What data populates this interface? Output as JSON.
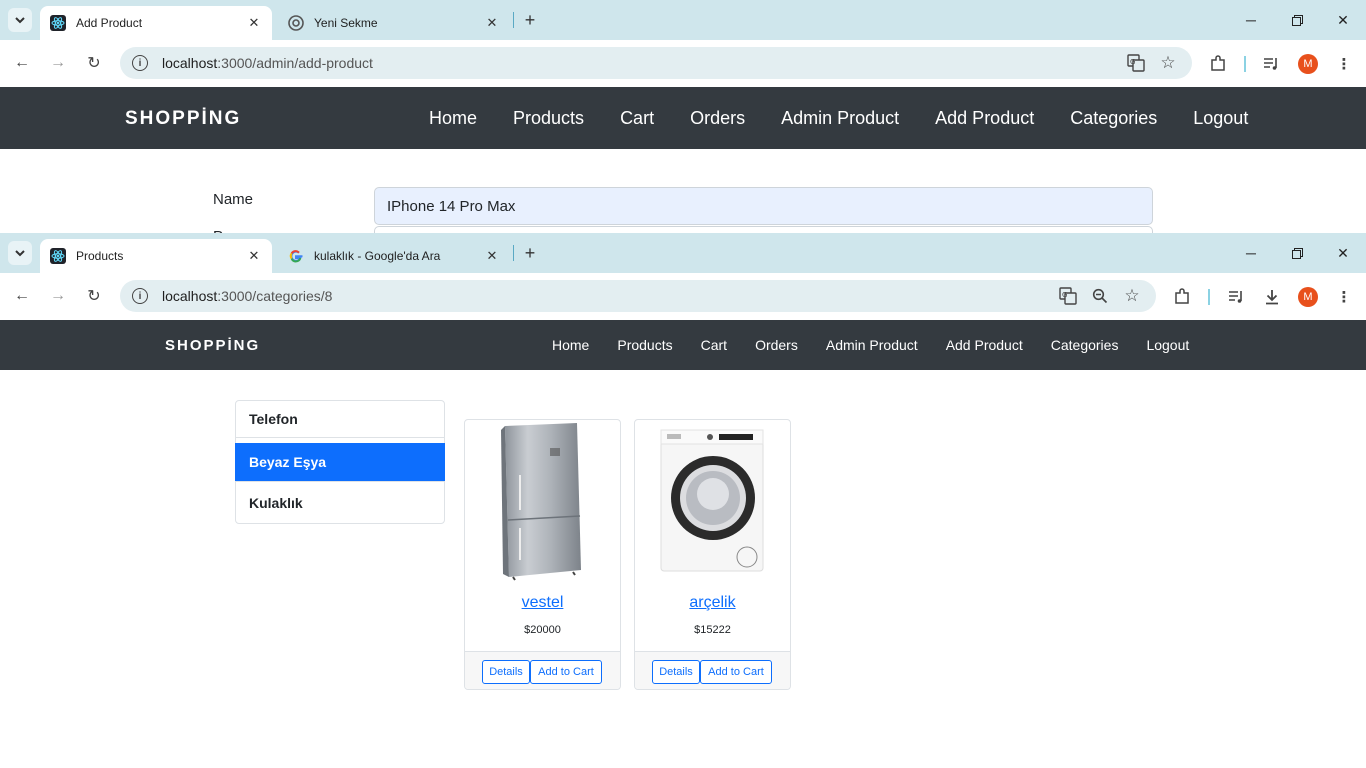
{
  "window1": {
    "tabs": [
      {
        "title": "Add Product",
        "active": true
      },
      {
        "title": "Yeni Sekme",
        "active": false
      }
    ],
    "url_host": "localhost",
    "url_rest": ":3000/admin/add-product",
    "brand": "SHOPPİNG",
    "nav": [
      "Home",
      "Products",
      "Cart",
      "Orders",
      "Admin Product",
      "Add Product",
      "Categories",
      "Logout"
    ],
    "form": {
      "name_label": "Name",
      "name_value": "IPhone 14 Pro Max",
      "next_label": "Pr"
    },
    "avatar_letter": "M"
  },
  "window2": {
    "tabs": [
      {
        "title": "Products",
        "active": true
      },
      {
        "title": "kulaklık - Google'da Ara",
        "active": false
      }
    ],
    "url_host": "localhost",
    "url_rest": ":3000/categories/8",
    "brand": "SHOPPİNG",
    "nav": [
      "Home",
      "Products",
      "Cart",
      "Orders",
      "Admin Product",
      "Add Product",
      "Categories",
      "Logout"
    ],
    "categories": [
      {
        "name": "Telefon",
        "active": false
      },
      {
        "name": "Beyaz Eşya",
        "active": true
      },
      {
        "name": "Kulaklık",
        "active": false
      }
    ],
    "products": [
      {
        "name": "vestel",
        "price": "$20000",
        "details_label": "Details",
        "cart_label": "Add to Cart",
        "image": "refrigerator-image"
      },
      {
        "name": "arçelik",
        "price": "$15222",
        "details_label": "Details",
        "cart_label": "Add to Cart",
        "image": "washing-machine-image"
      }
    ],
    "avatar_letter": "M"
  },
  "colors": {
    "navbar_bg": "#343a40",
    "primary": "#0d6efd",
    "tabstrip_bg": "#cfe6ec",
    "avatar": "#e8501c"
  }
}
